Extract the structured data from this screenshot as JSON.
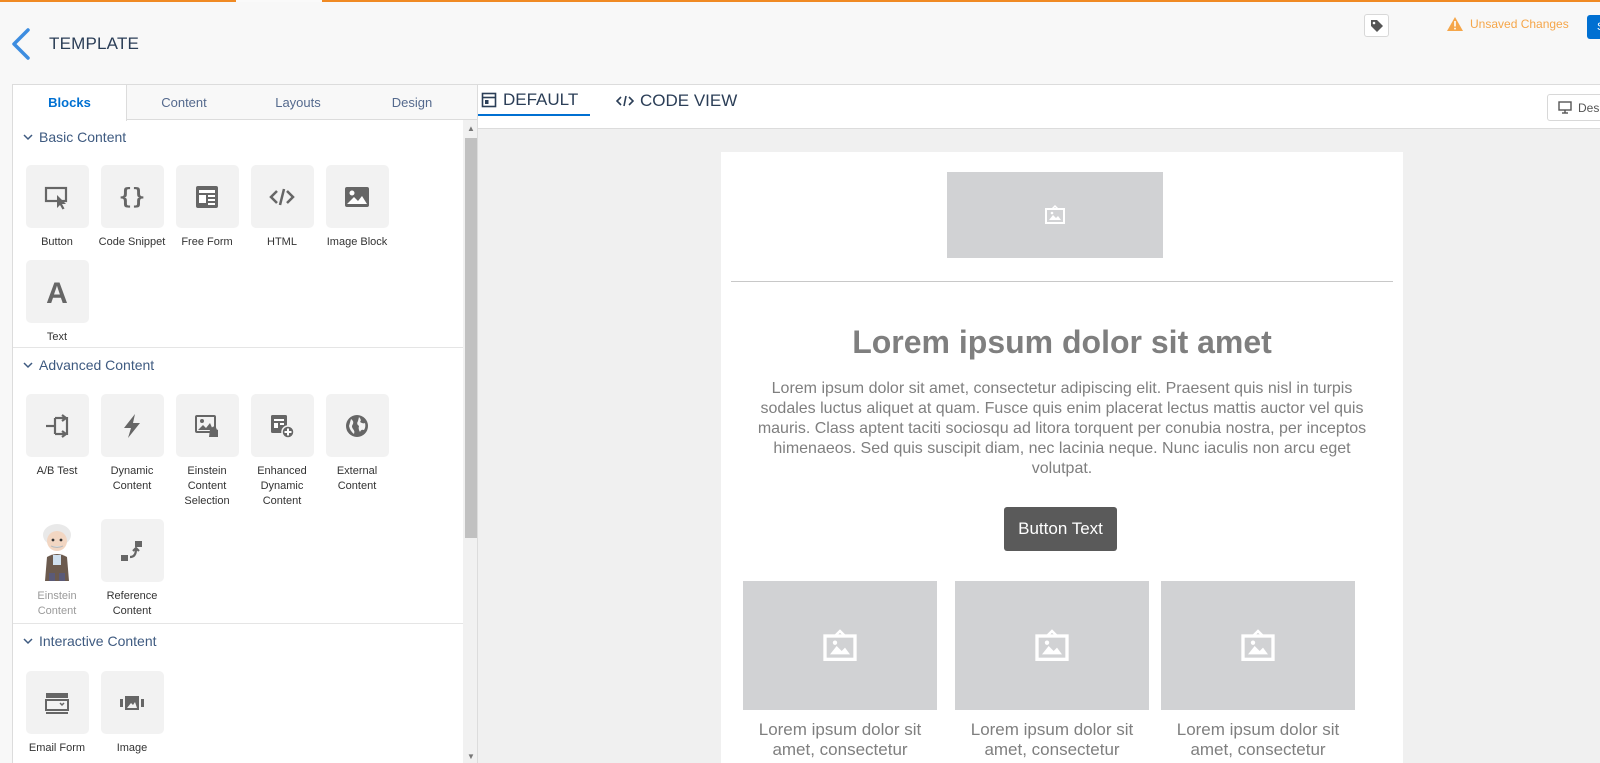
{
  "header": {
    "title": "TEMPLATE",
    "unsaved_label": "Unsaved Changes",
    "save_label": "S"
  },
  "panel": {
    "tabs": [
      "Blocks",
      "Content",
      "Layouts",
      "Design"
    ],
    "active_tab": "Blocks",
    "sections": [
      {
        "title": "Basic Content",
        "blocks": [
          {
            "label": "Button",
            "icon": "button-cursor-icon"
          },
          {
            "label": "Code Snippet",
            "icon": "code-braces-icon"
          },
          {
            "label": "Free Form",
            "icon": "free-form-icon"
          },
          {
            "label": "HTML",
            "icon": "html-code-icon"
          },
          {
            "label": "Image Block",
            "icon": "image-icon"
          },
          {
            "label": "Text",
            "icon": "text-a-icon"
          }
        ]
      },
      {
        "title": "Advanced Content",
        "blocks": [
          {
            "label": "A/B Test",
            "icon": "ab-test-icon"
          },
          {
            "label": "Dynamic Content",
            "icon": "lightning-icon"
          },
          {
            "label": "Einstein Content Selection",
            "icon": "einstein-selection-icon"
          },
          {
            "label": "Enhanced Dynamic Content",
            "icon": "enhanced-dynamic-icon"
          },
          {
            "label": "External Content",
            "icon": "globe-icon"
          },
          {
            "label": "Einstein Content",
            "icon": "einstein-avatar-icon"
          },
          {
            "label": "Reference Content",
            "icon": "reference-icon"
          }
        ]
      },
      {
        "title": "Interactive Content",
        "blocks": [
          {
            "label": "Email Form",
            "icon": "email-form-icon"
          },
          {
            "label": "Image",
            "icon": "image-carousel-icon"
          }
        ]
      }
    ]
  },
  "view": {
    "default_label": "DEFAULT",
    "code_label": "CODE VIEW",
    "device_label": "Des"
  },
  "email": {
    "heading": "Lorem ipsum dolor sit amet",
    "body": "Lorem ipsum dolor sit amet, consectetur adipiscing elit. Praesent quis nisl in turpis sodales luctus aliquet at quam. Fusce quis enim placerat lectus mattis auctor vel quis mauris. Class aptent taciti sociosqu ad litora torquent per conubia nostra, per inceptos himenaeos. Sed quis suscipit diam, nec lacinia neque. Nunc iaculis non arcu eget volutpat.",
    "button_text": "Button Text",
    "columns": [
      "Lorem ipsum dolor sit amet, consectetur",
      "Lorem ipsum dolor sit amet, consectetur",
      "Lorem ipsum dolor sit amet, consectetur"
    ]
  },
  "colors": {
    "accent": "#f08a24",
    "brand_blue": "#0070d2",
    "warning": "#f5a64a",
    "placeholder": "#d1d2d4",
    "icon_gray": "#666666"
  }
}
